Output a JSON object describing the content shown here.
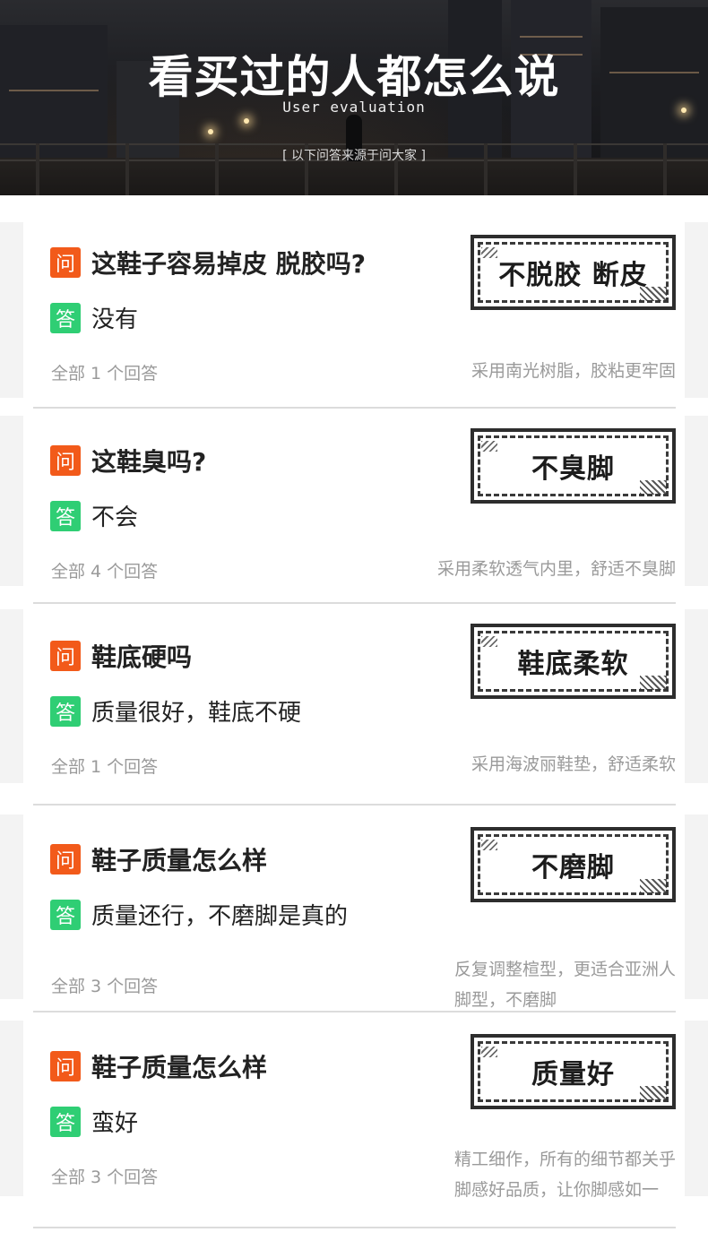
{
  "hero": {
    "title": "看买过的人都怎么说",
    "subtitle": "User evaluation",
    "note": "[ 以下问答来源于问大家 ]"
  },
  "labels": {
    "question_badge": "问",
    "answer_badge": "答"
  },
  "qa": [
    {
      "question": "这鞋子容易掉皮 脱胶吗?",
      "answer": "没有",
      "count": "全部 1 个回答",
      "stamp": "不脱胶 断皮",
      "feature_lines": [
        "采用南光树脂，胶粘更牢固"
      ]
    },
    {
      "question": "这鞋臭吗?",
      "answer": "不会",
      "count": "全部 4 个回答",
      "stamp": "不臭脚",
      "feature_lines": [
        "采用柔软透气内里，舒适不臭脚"
      ]
    },
    {
      "question": "鞋底硬吗",
      "answer": "质量很好，鞋底不硬",
      "count": "全部 1 个回答",
      "stamp": "鞋底柔软",
      "feature_lines": [
        "采用海波丽鞋垫，舒适柔软"
      ]
    },
    {
      "question": "鞋子质量怎么样",
      "answer": "质量还行，不磨脚是真的",
      "count": "全部 3 个回答",
      "stamp": "不磨脚",
      "feature_lines": [
        "反复调整楦型，更适合亚洲人",
        "脚型，不磨脚"
      ]
    },
    {
      "question": "鞋子质量怎么样",
      "answer": "蛮好",
      "count": "全部 3 个回答",
      "stamp": "质量好",
      "feature_lines": [
        "精工细作，所有的细节都关乎",
        "脚感好品质，让你脚感如一"
      ]
    }
  ],
  "colors": {
    "question_badge": "#f25a1a",
    "answer_badge": "#2fce74",
    "muted_text": "#9a9a9a"
  }
}
